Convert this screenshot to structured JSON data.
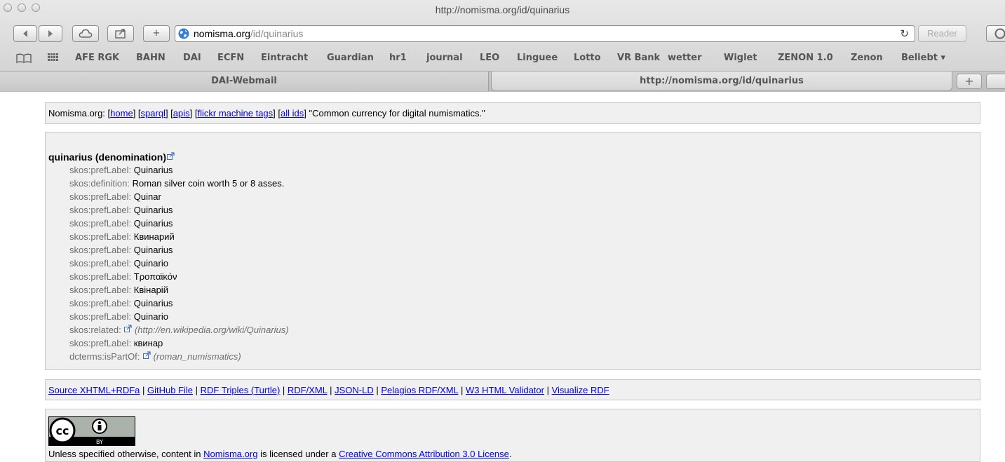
{
  "window": {
    "title": "http://nomisma.org/id/quinarius"
  },
  "toolbar": {
    "url_host": "nomisma.org",
    "url_path": "/id/quinarius",
    "reader_label": "Reader",
    "add_label": "+"
  },
  "bookmarks": [
    "AFE RGK",
    "BAHN",
    "DAI",
    "ECFN",
    "Eintracht",
    "Guardian",
    "hr1",
    "journal",
    "LEO",
    "Linguee",
    "Lotto",
    "VR Bank",
    "wetter",
    "Wiglet",
    "ZENON 1.0",
    "Zenon",
    "Beliebt ▾"
  ],
  "tabs": [
    {
      "label": "DAI-Webmail"
    },
    {
      "label": "http://nomisma.org/id/quinarius"
    }
  ],
  "nav": {
    "site": "Nomisma.org:",
    "links": [
      "home",
      "sparql",
      "apis",
      "flickr machine tags",
      "all ids"
    ],
    "tagline": "\"Common currency for digital numismatics.\""
  },
  "entity": {
    "title": "quinarius (denomination)",
    "properties": [
      {
        "key": "skos:prefLabel:",
        "value": "Quinarius"
      },
      {
        "key": "skos:definition:",
        "value": "Roman silver coin worth 5 or 8 asses."
      },
      {
        "key": "skos:prefLabel:",
        "value": "Quinar"
      },
      {
        "key": "skos:prefLabel:",
        "value": "Quinarius"
      },
      {
        "key": "skos:prefLabel:",
        "value": "Quinarius"
      },
      {
        "key": "skos:prefLabel:",
        "value": "Квинарий"
      },
      {
        "key": "skos:prefLabel:",
        "value": "Quinarius"
      },
      {
        "key": "skos:prefLabel:",
        "value": "Quinario"
      },
      {
        "key": "skos:prefLabel:",
        "value": "Τροπαϊκόν"
      },
      {
        "key": "skos:prefLabel:",
        "value": "Квінарій"
      },
      {
        "key": "skos:prefLabel:",
        "value": "Quinarius"
      },
      {
        "key": "skos:prefLabel:",
        "value": "Quinario"
      },
      {
        "key": "skos:related:",
        "link": "(http://en.wikipedia.org/wiki/Quinarius)"
      },
      {
        "key": "skos:prefLabel:",
        "value": "квинар"
      },
      {
        "key": "dcterms:isPartOf:",
        "link": "(roman_numismatics)"
      }
    ]
  },
  "formats": [
    "Source XHTML+RDFa",
    "GitHub File",
    "RDF Triples (Turtle)",
    "RDF/XML",
    "JSON-LD",
    "Pelagios RDF/XML",
    "W3 HTML Validator",
    "Visualize RDF"
  ],
  "license": {
    "badge_cc": "cc",
    "badge_by": "BY",
    "prefix": "Unless specified otherwise, content in",
    "site_link": "Nomisma.org",
    "middle": "is licensed under a",
    "license_link": "Creative Commons Attribution 3.0 License",
    "suffix": "."
  }
}
